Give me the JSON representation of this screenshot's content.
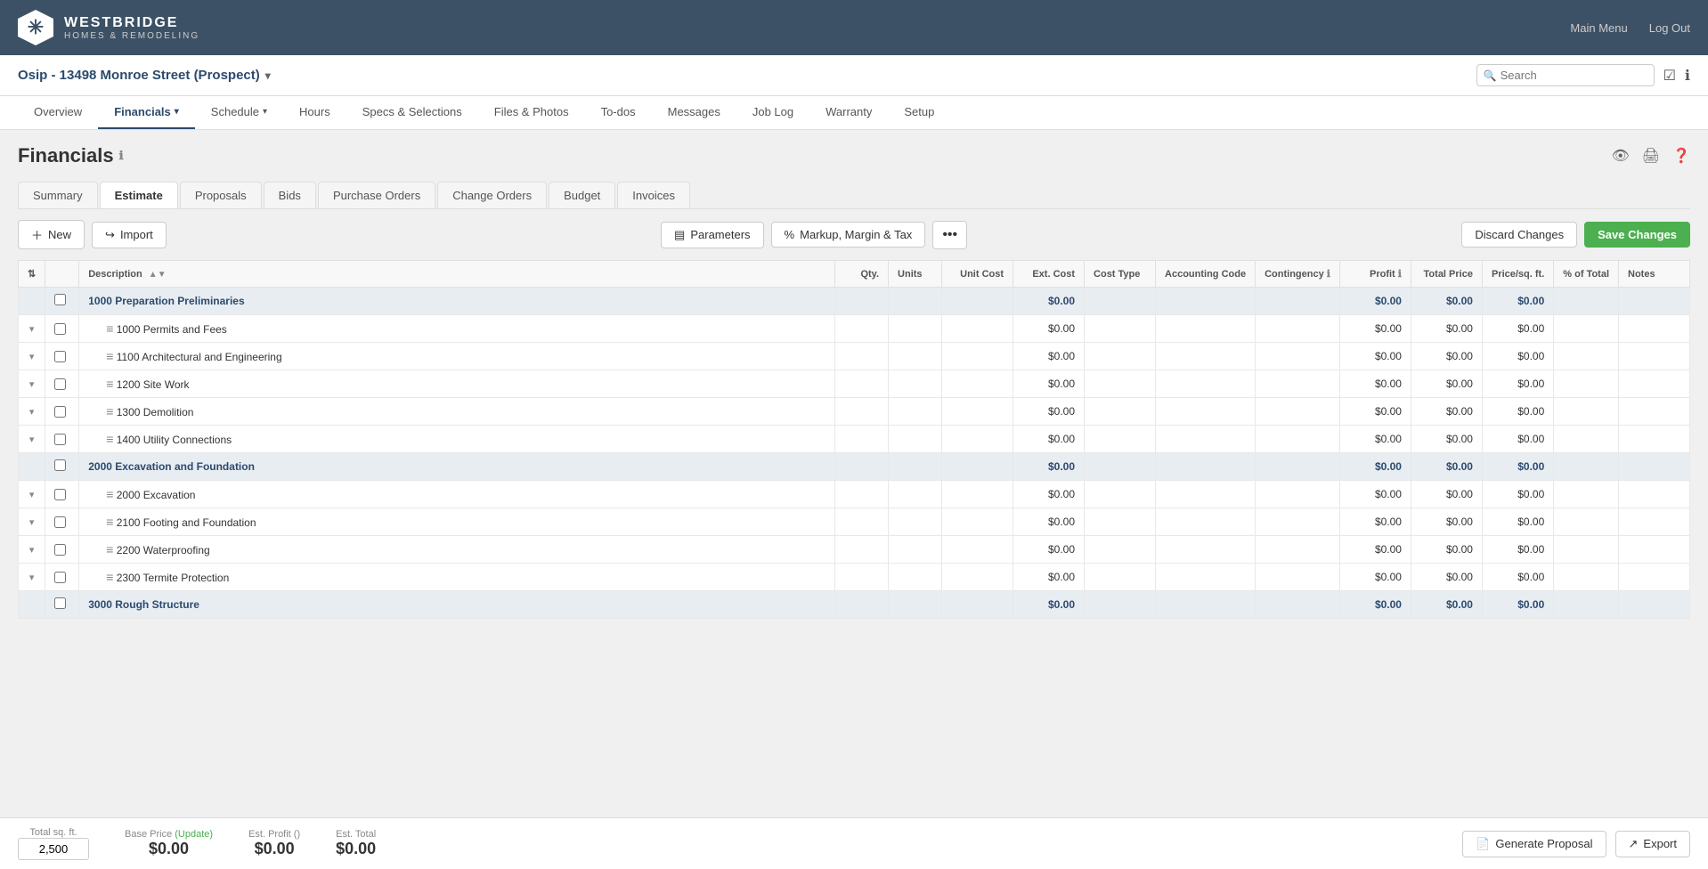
{
  "header": {
    "logo_company": "WESTBRIDGE",
    "logo_sub": "HOMES & REMODELING",
    "main_menu": "Main Menu",
    "log_out": "Log Out"
  },
  "project_bar": {
    "project_title": "Osip - 13498 Monroe Street (Prospect)",
    "search_placeholder": "Search"
  },
  "nav_tabs": [
    {
      "label": "Overview",
      "active": false
    },
    {
      "label": "Financials",
      "active": true,
      "dropdown": true
    },
    {
      "label": "Schedule",
      "active": false,
      "dropdown": true
    },
    {
      "label": "Hours",
      "active": false
    },
    {
      "label": "Specs & Selections",
      "active": false
    },
    {
      "label": "Files & Photos",
      "active": false
    },
    {
      "label": "To-dos",
      "active": false
    },
    {
      "label": "Messages",
      "active": false
    },
    {
      "label": "Job Log",
      "active": false
    },
    {
      "label": "Warranty",
      "active": false
    },
    {
      "label": "Setup",
      "active": false
    }
  ],
  "page_title": "Financials",
  "sub_tabs": [
    {
      "label": "Summary",
      "active": false
    },
    {
      "label": "Estimate",
      "active": true
    },
    {
      "label": "Proposals",
      "active": false
    },
    {
      "label": "Bids",
      "active": false
    },
    {
      "label": "Purchase Orders",
      "active": false
    },
    {
      "label": "Change Orders",
      "active": false
    },
    {
      "label": "Budget",
      "active": false
    },
    {
      "label": "Invoices",
      "active": false
    }
  ],
  "toolbar": {
    "new_btn": "New",
    "import_btn": "Import",
    "parameters_btn": "Parameters",
    "markup_btn": "Markup, Margin & Tax",
    "discard_btn": "Discard Changes",
    "save_btn": "Save Changes"
  },
  "table_headers": {
    "description": "Description",
    "qty": "Qty.",
    "units": "Units",
    "unit_cost": "Unit Cost",
    "ext_cost": "Ext. Cost",
    "cost_type": "Cost Type",
    "accounting_code": "Accounting Code",
    "contingency": "Contingency",
    "profit": "Profit",
    "total_price": "Total Price",
    "price_sqft": "Price/sq. ft.",
    "pct_total": "% of Total",
    "notes": "Notes"
  },
  "table_rows": [
    {
      "id": "s1",
      "section": true,
      "desc": "1000 Preparation Preliminaries",
      "ext_cost": "$0.00",
      "profit": "$0.00",
      "total": "$0.00",
      "ppsf": "$0.00"
    },
    {
      "id": "r1",
      "section": false,
      "indent": 1,
      "desc": "1000 Permits and Fees",
      "ext_cost": "$0.00",
      "profit": "$0.00",
      "total": "$0.00",
      "ppsf": "$0.00"
    },
    {
      "id": "r2",
      "section": false,
      "indent": 1,
      "desc": "1100 Architectural and Engineering",
      "ext_cost": "$0.00",
      "profit": "$0.00",
      "total": "$0.00",
      "ppsf": "$0.00"
    },
    {
      "id": "r3",
      "section": false,
      "indent": 1,
      "desc": "1200 Site Work",
      "ext_cost": "$0.00",
      "profit": "$0.00",
      "total": "$0.00",
      "ppsf": "$0.00"
    },
    {
      "id": "r4",
      "section": false,
      "indent": 1,
      "desc": "1300 Demolition",
      "ext_cost": "$0.00",
      "profit": "$0.00",
      "total": "$0.00",
      "ppsf": "$0.00"
    },
    {
      "id": "r5",
      "section": false,
      "indent": 1,
      "desc": "1400 Utility Connections",
      "ext_cost": "$0.00",
      "profit": "$0.00",
      "total": "$0.00",
      "ppsf": "$0.00"
    },
    {
      "id": "s2",
      "section": true,
      "desc": "2000 Excavation and Foundation",
      "ext_cost": "$0.00",
      "profit": "$0.00",
      "total": "$0.00",
      "ppsf": "$0.00"
    },
    {
      "id": "r6",
      "section": false,
      "indent": 1,
      "desc": "2000 Excavation",
      "ext_cost": "$0.00",
      "profit": "$0.00",
      "total": "$0.00",
      "ppsf": "$0.00"
    },
    {
      "id": "r7",
      "section": false,
      "indent": 1,
      "desc": "2100 Footing and Foundation",
      "ext_cost": "$0.00",
      "profit": "$0.00",
      "total": "$0.00",
      "ppsf": "$0.00"
    },
    {
      "id": "r8",
      "section": false,
      "indent": 1,
      "desc": "2200 Waterproofing",
      "ext_cost": "$0.00",
      "profit": "$0.00",
      "total": "$0.00",
      "ppsf": "$0.00"
    },
    {
      "id": "r9",
      "section": false,
      "indent": 1,
      "desc": "2300 Termite Protection",
      "ext_cost": "$0.00",
      "profit": "$0.00",
      "total": "$0.00",
      "ppsf": "$0.00"
    },
    {
      "id": "s3",
      "section": true,
      "desc": "3000 Rough Structure",
      "ext_cost": "$0.00",
      "profit": "$0.00",
      "total": "$0.00",
      "ppsf": "$0.00"
    }
  ],
  "footer": {
    "total_sqft_label": "Total sq. ft.",
    "total_sqft_value": "2,500",
    "base_price_label": "Base Price",
    "base_price_update": "(Update)",
    "base_price_value": "$0.00",
    "est_profit_label": "Est. Profit ()",
    "est_profit_value": "$0.00",
    "est_total_label": "Est. Total",
    "est_total_value": "$0.00",
    "generate_proposal_btn": "Generate Proposal",
    "export_btn": "Export"
  }
}
